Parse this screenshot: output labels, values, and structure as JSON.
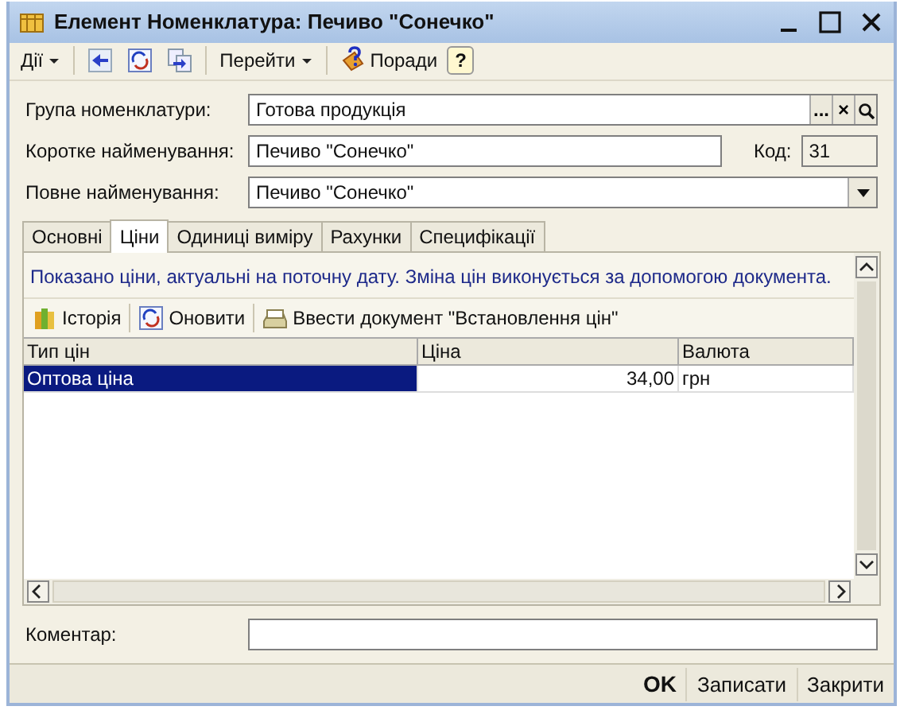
{
  "window": {
    "title": "Елемент Номенклатура: Печиво \"Сонечко\""
  },
  "toolbar": [
    {
      "kind": "menu",
      "label": "Дії"
    },
    {
      "kind": "icon"
    },
    {
      "kind": "icon"
    },
    {
      "kind": "icon"
    },
    {
      "kind": "menu",
      "label": "Перейти"
    },
    {
      "kind": "help",
      "label": "Поради"
    },
    {
      "kind": "question",
      "label": "?"
    }
  ],
  "fields": [
    {
      "kind": "select",
      "label": "Група номенклатури:",
      "value": "Готова продукція",
      "buttons": [
        "...",
        "×"
      ]
    },
    {
      "kind": "code",
      "label": "Коротке найменування:",
      "value": "Печиво \"Сонечко\"",
      "code_label": "Код:",
      "code_value": "31"
    },
    {
      "kind": "dropdown",
      "label": "Повне найменування:",
      "value": "Печиво \"Сонечко\""
    }
  ],
  "tabs": [
    {
      "label": "Основні",
      "selected": false
    },
    {
      "label": "Ціни",
      "selected": true
    },
    {
      "label": "Одиниці виміру",
      "selected": false
    },
    {
      "label": "Рахунки",
      "selected": false
    },
    {
      "label": "Специфікації",
      "selected": false
    }
  ],
  "prices": {
    "note": "Показано ціни, актуальні на поточну дату. Зміна цін виконується за допомогою документа.",
    "actions": [
      {
        "label": "Історія"
      },
      {
        "label": "Оновити"
      },
      {
        "label": "Ввести документ \"Встановлення цін\""
      }
    ],
    "columns": [
      "Тип цін",
      "Ціна",
      "Валюта"
    ],
    "rows": [
      {
        "cells": [
          "Оптова ціна",
          "34,00",
          "грн"
        ],
        "selected": true
      }
    ]
  },
  "comment": {
    "label": "Коментар:"
  },
  "footer": [
    {
      "label": "OK",
      "primary": true
    },
    {
      "label": "Записати",
      "primary": false
    },
    {
      "label": "Закрити",
      "primary": false
    }
  ]
}
